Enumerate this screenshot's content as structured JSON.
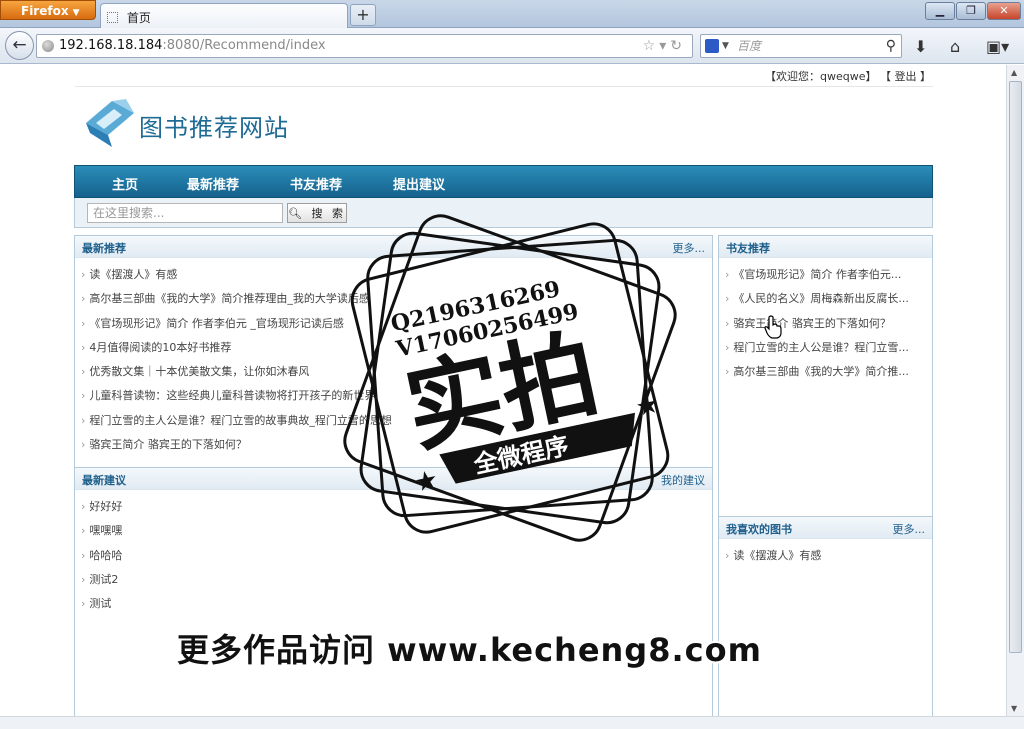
{
  "browser": {
    "app_button": "Firefox",
    "tab_title": "首页",
    "new_tab": "+",
    "url_host": "192.168.18.184",
    "url_rest": ":8080/Recommend/index",
    "search_placeholder": "百度"
  },
  "header": {
    "welcome": "【欢迎您：qweqwe】",
    "logout": "【 登出 】",
    "logo_text": "图书推荐网站"
  },
  "nav": {
    "items": [
      {
        "label": "主页"
      },
      {
        "label": "最新推荐"
      },
      {
        "label": "书友推荐"
      },
      {
        "label": "提出建议"
      }
    ]
  },
  "search": {
    "placeholder": "在这里搜索...",
    "button": "搜 索"
  },
  "latest": {
    "title": "最新推荐",
    "more": "更多...",
    "items": [
      "读《摆渡人》有感",
      "高尔基三部曲《我的大学》简介推荐理由_我的大学读后感",
      "《官场现形记》简介 作者李伯元 _官场现形记读后感",
      "4月值得阅读的10本好书推荐",
      "优秀散文集｜十本优美散文集，让你如沐春风",
      "儿童科普读物：这些经典儿童科普读物将打开孩子的新世界",
      "程门立雪的主人公是谁？程门立雪的故事典故_程门立雪的思想",
      "骆宾王简介 骆宾王的下落如何？"
    ]
  },
  "suggestions": {
    "title": "最新建议",
    "more": "我的建议",
    "items": [
      "好好好",
      "嘿嘿嘿",
      "哈哈哈",
      "测试2",
      "测试"
    ]
  },
  "friends": {
    "title": "书友推荐",
    "items": [
      "《官场现形记》简介 作者李伯元...",
      "《人民的名义》周梅森新出反腐长...",
      "骆宾王简介 骆宾王的下落如何？",
      "程门立雪的主人公是谁？程门立雪...",
      "高尔基三部曲《我的大学》简介推..."
    ]
  },
  "favorites": {
    "title": "我喜欢的图书",
    "more": "更多...",
    "items": [
      "读《摆渡人》有感"
    ]
  },
  "overlay": {
    "qq": "Q2196316269",
    "vx": "V17060256499",
    "stamp_main": "实拍",
    "stamp_banner": "全微程序",
    "watermark": "更多作品访问 www.kecheng8.com"
  }
}
